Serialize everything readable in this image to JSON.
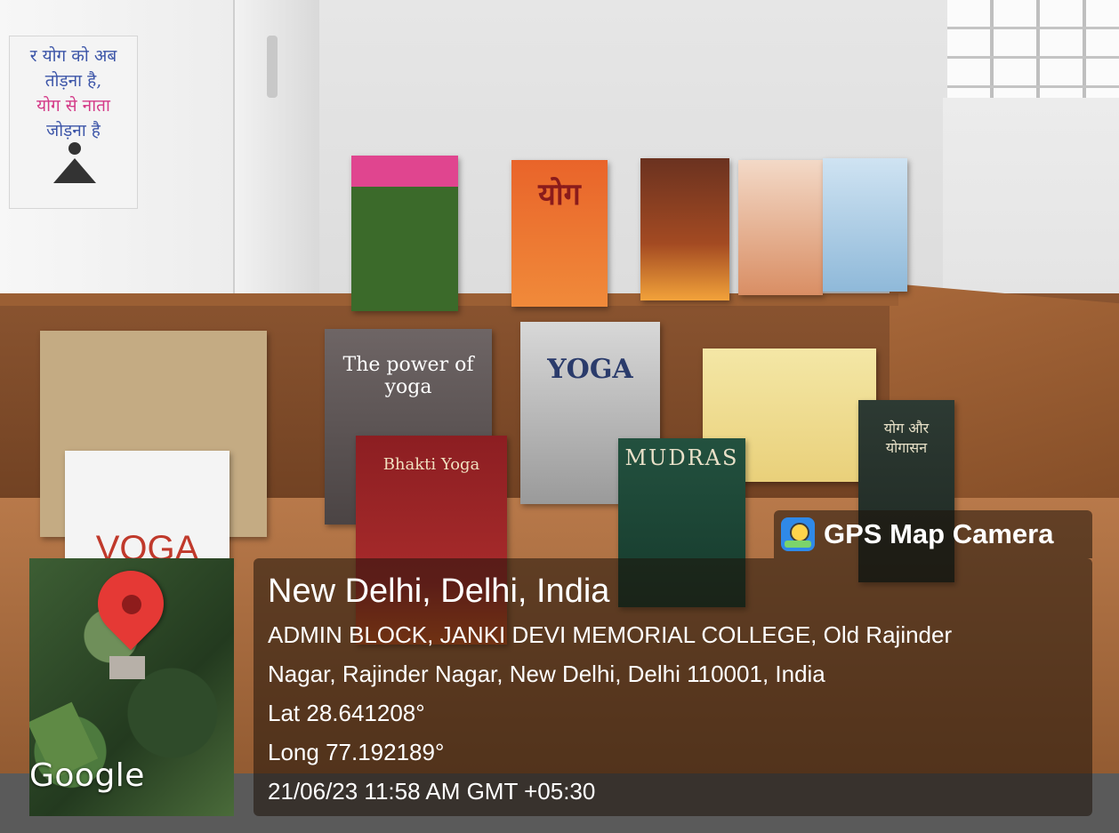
{
  "photo": {
    "poster_text": [
      "र योग को अब",
      "तोड़ना है,",
      "योग से नाता",
      "जोड़ना है"
    ],
    "book_titles": [
      "योग",
      "The power of yoga",
      "YOGA",
      "MUDRAS",
      "Bhakti Yoga",
      "VOGA",
      "योग और योगासन"
    ]
  },
  "overlay": {
    "badge_label": "GPS Map Camera",
    "map_watermark": "Google",
    "place_title": "New Delhi, Delhi, India",
    "address_line1": "ADMIN BLOCK, JANKI DEVI MEMORIAL COLLEGE, Old Rajinder",
    "address_line2": "Nagar, Rajinder Nagar, New Delhi, Delhi 110001, India",
    "latitude": "Lat 28.641208°",
    "longitude": "Long 77.192189°",
    "timestamp": "21/06/23 11:58 AM GMT +05:30"
  },
  "colors": {
    "overlay_bg": "#1e120a",
    "pin": "#e53935",
    "badge_icon": "#2f89e8"
  }
}
